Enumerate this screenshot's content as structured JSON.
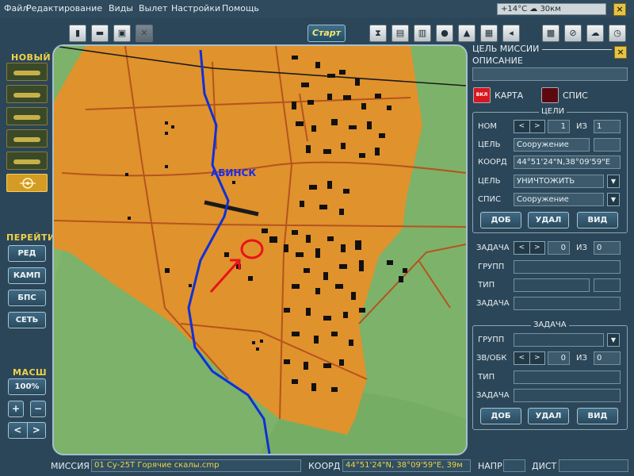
{
  "menu": {
    "items": [
      "Файл",
      "Редактирование",
      "Виды",
      "Вылет",
      "Настройки",
      "Помощь"
    ],
    "weather": "+14°C ☁ 30км",
    "close": "×"
  },
  "toolbar": {
    "start_label": "Старт",
    "left_icons": [
      "new-file-icon",
      "open-folder-icon",
      "save-icon",
      "close-file-icon"
    ],
    "right_icons": [
      "hourglass-icon",
      "document-icon",
      "notebook-icon",
      "head-icon",
      "tank-icon",
      "book-icon",
      "speaker-icon",
      "print-icon",
      "cancel-icon",
      "cloud-icon",
      "clock-icon"
    ],
    "glyphs": {
      "new": "▮",
      "open": "▬",
      "save": "▣",
      "closefile": "✕",
      "hourglass": "⧗",
      "document": "▤",
      "notebook": "▥",
      "head": "●",
      "tank": "▲",
      "book": "▦",
      "speaker": "◂",
      "print": "▩",
      "cancel": "⊘",
      "cloud": "☁",
      "clock": "◷"
    }
  },
  "left_panel": {
    "new_label": "НОВЫЙ",
    "goto_label": "ПЕРЕЙТИ",
    "goto_buttons": [
      "РЕД",
      "КАМП",
      "БПС",
      "СЕТЬ"
    ],
    "scale_label": "МАСШ",
    "scale_value": "100%",
    "zoom_in": "+",
    "zoom_out": "−",
    "prev": "<",
    "next": ">"
  },
  "map": {
    "city_label": "АБИНСК"
  },
  "right_panel": {
    "header_title": "ЦЕЛЬ МИССИИ",
    "description_label": "ОПИСАНИЕ",
    "description_value": "",
    "toggle_on": "ВКЛ",
    "map_toggle_label": "КАРТА",
    "list_toggle_label": "СПИС",
    "targets": {
      "title": "ЦЕЛИ",
      "num_label": "НОМ",
      "num_value": "1",
      "of_label": "ИЗ",
      "of_value": "1",
      "target_label": "ЦЕЛЬ",
      "target_value": "Сооружение",
      "coord_label": "КООРД",
      "coord_value": "44°51'24\"N,38°09'59\"E",
      "goal_label": "ЦЕЛЬ",
      "goal_value": "УНИЧТОЖИТЬ",
      "list_label": "СПИС",
      "list_value": "Сооружение",
      "add": "ДОБ",
      "delete": "УДАЛ",
      "view": "ВИД"
    },
    "task_section": {
      "task_label": "ЗАДАЧА",
      "task_value": "0",
      "of_label": "ИЗ",
      "of_value": "0",
      "group_label": "ГРУПП",
      "type_label": "ТИП",
      "task2_label": "ЗАДАЧА"
    },
    "task_box": {
      "title": "ЗАДАЧА",
      "group_label": "ГРУПП",
      "flight_label": "ЗВ/ОБК",
      "flight_value": "0",
      "of_label": "ИЗ",
      "of_value": "0",
      "type_label": "ТИП",
      "task_label": "ЗАДАЧА",
      "add": "ДОБ",
      "delete": "УДАЛ",
      "view": "ВИД"
    }
  },
  "status_bar": {
    "mission_label": "МИССИЯ",
    "mission_value": "01 Су-25Т Горячие скалы.cmp",
    "coord_label": "КООРД",
    "coord_value": "44°51'24\"N, 38°09'59\"E, 39м",
    "heading_label": "НАПР",
    "distance_label": "ДИСТ"
  },
  "colors": {
    "background": "#2b4658",
    "town": "#e0922c",
    "terrain": "#7db26a",
    "river": "#1030d8",
    "road": "#b5541e",
    "accent_yellow": "#f0d24a",
    "marker_red": "#e8121a"
  }
}
